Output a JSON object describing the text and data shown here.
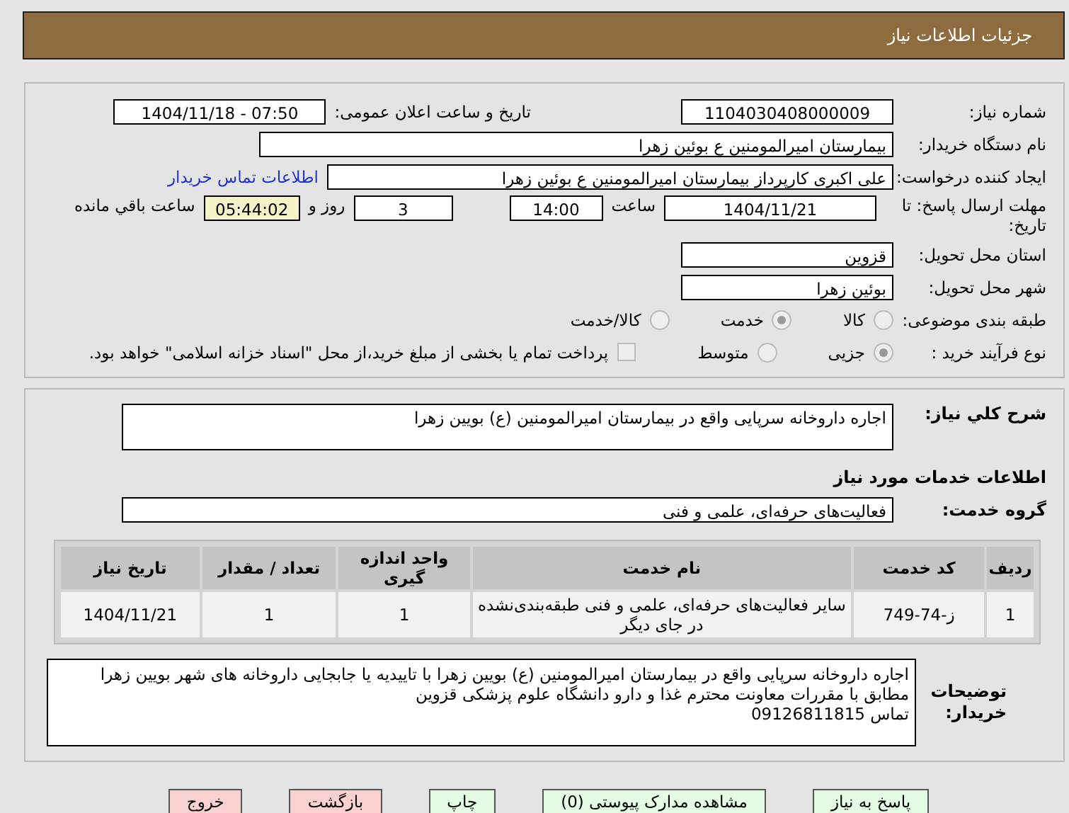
{
  "title": "جزئیات اطلاعات نیاز",
  "need_number": {
    "label": "شماره نیاز:",
    "value": "1104030408000009"
  },
  "announce": {
    "label": "تاریخ و ساعت اعلان عمومی:",
    "value": "1404/11/18 - 07:50"
  },
  "buyer_org": {
    "label": "نام دستگاه خریدار:",
    "value": "بیمارستان امیرالمومنین ع  بوئین زهرا"
  },
  "requester": {
    "label": "ایجاد کننده درخواست:",
    "value": "علی اکبری کارپرداز بیمارستان امیرالمومنین ع  بوئین زهرا",
    "link": "اطلاعات تماس خریدار"
  },
  "deadline": {
    "label": "مهلت ارسال پاسخ: تا تاریخ:",
    "date": "1404/11/21",
    "time_label": "ساعت",
    "time": "14:00",
    "days": "3",
    "days_label": "روز و",
    "remaining": "05:44:02",
    "remaining_label": "ساعت باقي مانده"
  },
  "province": {
    "label": "استان محل تحویل:",
    "value": "قزوین"
  },
  "city": {
    "label": "شهر محل تحویل:",
    "value": "بوئین زهرا"
  },
  "category": {
    "label": "طبقه بندی موضوعی:",
    "options": [
      {
        "label": "کالا",
        "selected": false
      },
      {
        "label": "خدمت",
        "selected": true
      },
      {
        "label": "کالا/خدمت",
        "selected": false
      }
    ]
  },
  "purchase_process": {
    "label": "نوع فرآیند خرید :",
    "options": [
      {
        "label": "جزیی",
        "selected": true
      },
      {
        "label": "متوسط",
        "selected": false
      }
    ],
    "payment": {
      "label": "پرداخت تمام یا بخشی از مبلغ خرید،از محل \"اسناد خزانه اسلامی\" خواهد بود.",
      "checked": false
    }
  },
  "description": {
    "label": "شرح کلي نياز:",
    "value": "اجاره  داروخانه سرپایی واقع در بیمارستان امیرالمومنین (ع) بویین زهرا"
  },
  "services_heading": "اطلاعات خدمات مورد نیاز",
  "service_group": {
    "label": "گروه خدمت:",
    "value": "فعالیت‌های حرفه‌ای، علمی و فنی"
  },
  "table": {
    "columns": [
      "ردیف",
      "کد خدمت",
      "نام خدمت",
      "واحد اندازه گیری",
      "تعداد / مقدار",
      "تاریخ نیاز"
    ],
    "rows": [
      [
        "1",
        "ز-74-749",
        "سایر فعالیت‌های حرفه‌ای، علمی و فنی طبقه‌بندی‌نشده در جای دیگر",
        "1",
        "1",
        "1404/11/21"
      ]
    ]
  },
  "buyer_notes": {
    "label": "توضیحات خریدار:",
    "value": "اجاره  داروخانه سرپایی واقع در بیمارستان امیرالمومنین (ع) بویین زهرا با تاییدیه یا جابجایی داروخانه های شهر بویین زهرا مطابق با مقررات معاونت محترم غذا و دارو دانشگاه علوم پزشکی قزوین\nتماس 09126811815"
  },
  "buttons": [
    {
      "label": "پاسخ به نیاز",
      "kind": "green"
    },
    {
      "label": "مشاهده مدارک پیوستی (0)",
      "kind": "green"
    },
    {
      "label": "چاپ",
      "kind": "green"
    },
    {
      "label": "بازگشت",
      "kind": "red"
    },
    {
      "label": "خروج",
      "kind": "red"
    }
  ]
}
